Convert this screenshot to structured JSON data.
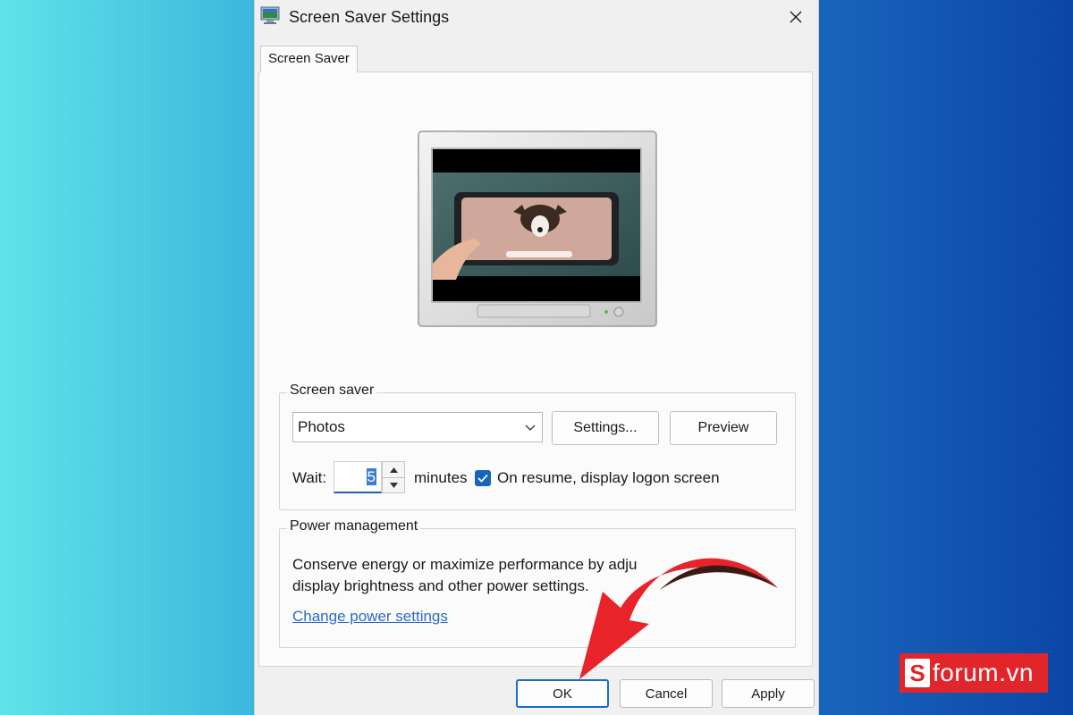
{
  "window": {
    "title": "Screen Saver Settings",
    "icon": "monitor-icon",
    "close_icon": "close-icon"
  },
  "tabs": [
    {
      "label": "Screen Saver",
      "selected": true
    }
  ],
  "screen_saver_group": {
    "legend": "Screen saver",
    "selected_saver": "Photos",
    "settings_label": "Settings...",
    "preview_label": "Preview",
    "wait_label": "Wait:",
    "wait_value": "5",
    "minutes_label": "minutes",
    "resume_checked": true,
    "resume_label": "On resume, display logon screen"
  },
  "power_group": {
    "legend": "Power management",
    "line1": "Conserve energy or maximize performance by adju",
    "line2": "display brightness and other power settings.",
    "link": "Change power settings"
  },
  "footer": {
    "ok_label": "OK",
    "cancel_label": "Cancel",
    "apply_label": "Apply"
  },
  "watermark": {
    "letter": "S",
    "text": "forum.vn"
  },
  "colors": {
    "accent": "#1764b8",
    "link": "#2a6bc4",
    "arrow": "#e8232a",
    "logo_bg": "#e2252b"
  }
}
